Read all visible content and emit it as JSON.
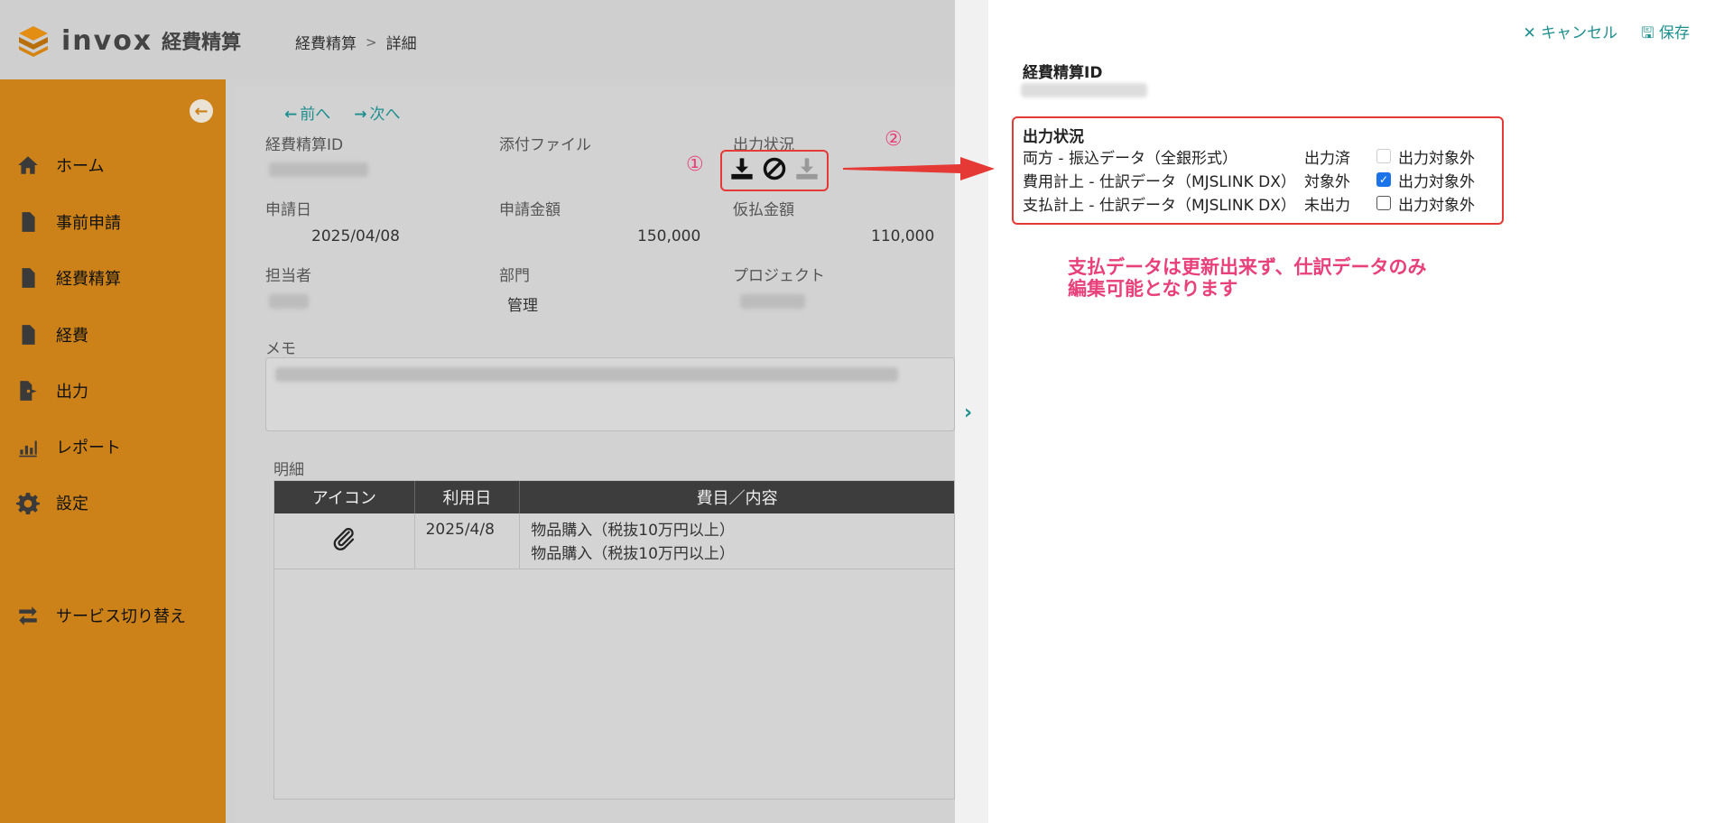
{
  "app": {
    "logo_text": "invox",
    "logo_sub": "経費精算"
  },
  "breadcrumb": {
    "root": "経費精算",
    "sep": ">",
    "current": "詳細"
  },
  "sidebar": {
    "items": [
      {
        "label": "ホーム",
        "icon": "home-icon"
      },
      {
        "label": "事前申請",
        "icon": "document-icon"
      },
      {
        "label": "経費精算",
        "icon": "document-icon"
      },
      {
        "label": "経費",
        "icon": "document-icon"
      },
      {
        "label": "出力",
        "icon": "file-export-icon"
      },
      {
        "label": "レポート",
        "icon": "chart-icon"
      },
      {
        "label": "設定",
        "icon": "gear-icon"
      },
      {
        "label": "サービス切り替え",
        "icon": "switch-icon"
      }
    ]
  },
  "main": {
    "prev": "前へ",
    "next": "次へ",
    "labels": {
      "id": "経費精算ID",
      "attachment": "添付ファイル",
      "output_status": "出力状況",
      "apply_date": "申請日",
      "apply_amount": "申請金額",
      "advance_amount": "仮払金額",
      "owner": "担当者",
      "dept": "部門",
      "project": "プロジェクト",
      "memo": "メモ",
      "detail": "明細"
    },
    "values": {
      "apply_date": "2025/04/08",
      "apply_amount": "150,000",
      "advance_amount": "110,000",
      "dept": "管理"
    },
    "marker_1": "①",
    "table": {
      "headers": [
        "アイコン",
        "利用日",
        "費目／内容"
      ],
      "rows": [
        {
          "date": "2025/4/8",
          "line1": "物品購入（税抜10万円以上）",
          "line2": "物品購入（税抜10万円以上）"
        }
      ]
    }
  },
  "drawer": {
    "cancel": "キャンセル",
    "save": "保存",
    "id_label": "経費精算ID",
    "marker_2": "②",
    "status_title": "出力状況",
    "rows": [
      {
        "name": "両方 - 振込データ（全銀形式）",
        "state": "出力済",
        "cb_label": "出力対象外",
        "checked": false,
        "disabled": true
      },
      {
        "name": "費用計上 - 仕訳データ（MJSLINK DX）",
        "state": "対象外",
        "cb_label": "出力対象外",
        "checked": true,
        "disabled": false
      },
      {
        "name": "支払計上 - 仕訳データ（MJSLINK DX）",
        "state": "未出力",
        "cb_label": "出力対象外",
        "checked": false,
        "disabled": false
      }
    ],
    "note_line1": "支払データは更新出来ず、仕訳データのみ",
    "note_line2": "編集可能となります"
  },
  "colors": {
    "accent": "#1e8f8f",
    "sidebar": "#cc8218",
    "annotation": "#e8407a",
    "highlight": "#e53935"
  }
}
